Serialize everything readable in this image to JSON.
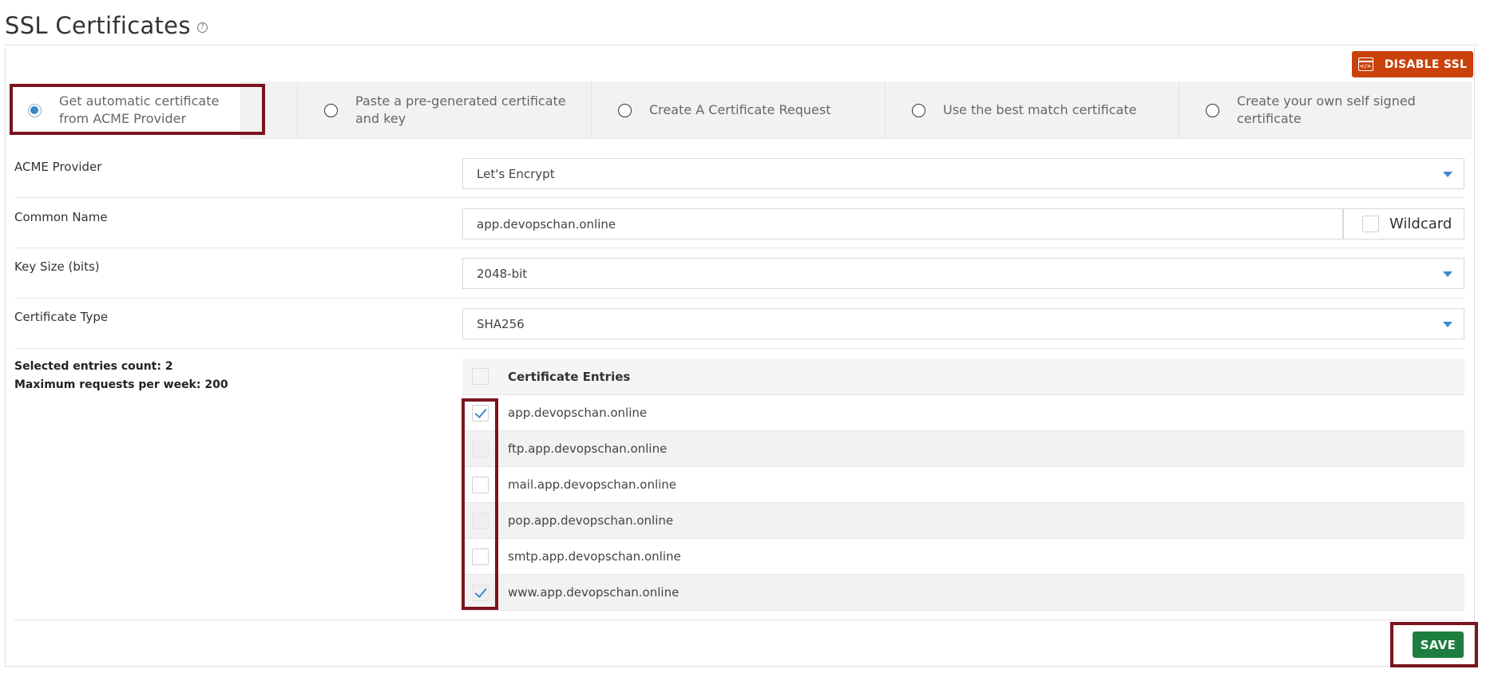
{
  "page": {
    "title": "SSL Certificates",
    "help_icon": "?",
    "disable_ssl_label": "DISABLE SSL"
  },
  "tabs": [
    {
      "label": "Get automatic certificate from ACME Provider",
      "selected": true
    },
    {
      "label": "Paste a pre-generated certificate and key",
      "selected": false
    },
    {
      "label": "Create A Certificate Request",
      "selected": false
    },
    {
      "label": "Use the best match certificate",
      "selected": false
    },
    {
      "label": "Create your own self signed certificate",
      "selected": false
    }
  ],
  "form": {
    "acme_provider": {
      "label": "ACME Provider",
      "value": "Let's Encrypt"
    },
    "common_name": {
      "label": "Common Name",
      "value": "app.devopschan.online",
      "wildcard_label": "Wildcard",
      "wildcard_checked": false
    },
    "key_size": {
      "label": "Key Size (bits)",
      "value": "2048-bit"
    },
    "certificate_type": {
      "label": "Certificate Type",
      "value": "SHA256"
    }
  },
  "summary": {
    "selected_count": "Selected entries count: 2",
    "max_requests": "Maximum requests per week: 200"
  },
  "entries": {
    "header": "Certificate Entries",
    "items": [
      {
        "name": "app.devopschan.online",
        "checked": true
      },
      {
        "name": "ftp.app.devopschan.online",
        "checked": false
      },
      {
        "name": "mail.app.devopschan.online",
        "checked": false
      },
      {
        "name": "pop.app.devopschan.online",
        "checked": false
      },
      {
        "name": "smtp.app.devopschan.online",
        "checked": false
      },
      {
        "name": "www.app.devopschan.online",
        "checked": true
      }
    ]
  },
  "actions": {
    "save_label": "SAVE"
  },
  "colors": {
    "disable_button": "#c9410b",
    "save_button": "#1e7e3f",
    "highlight_outline": "#7a1420",
    "accent_blue": "#3e8acc"
  }
}
